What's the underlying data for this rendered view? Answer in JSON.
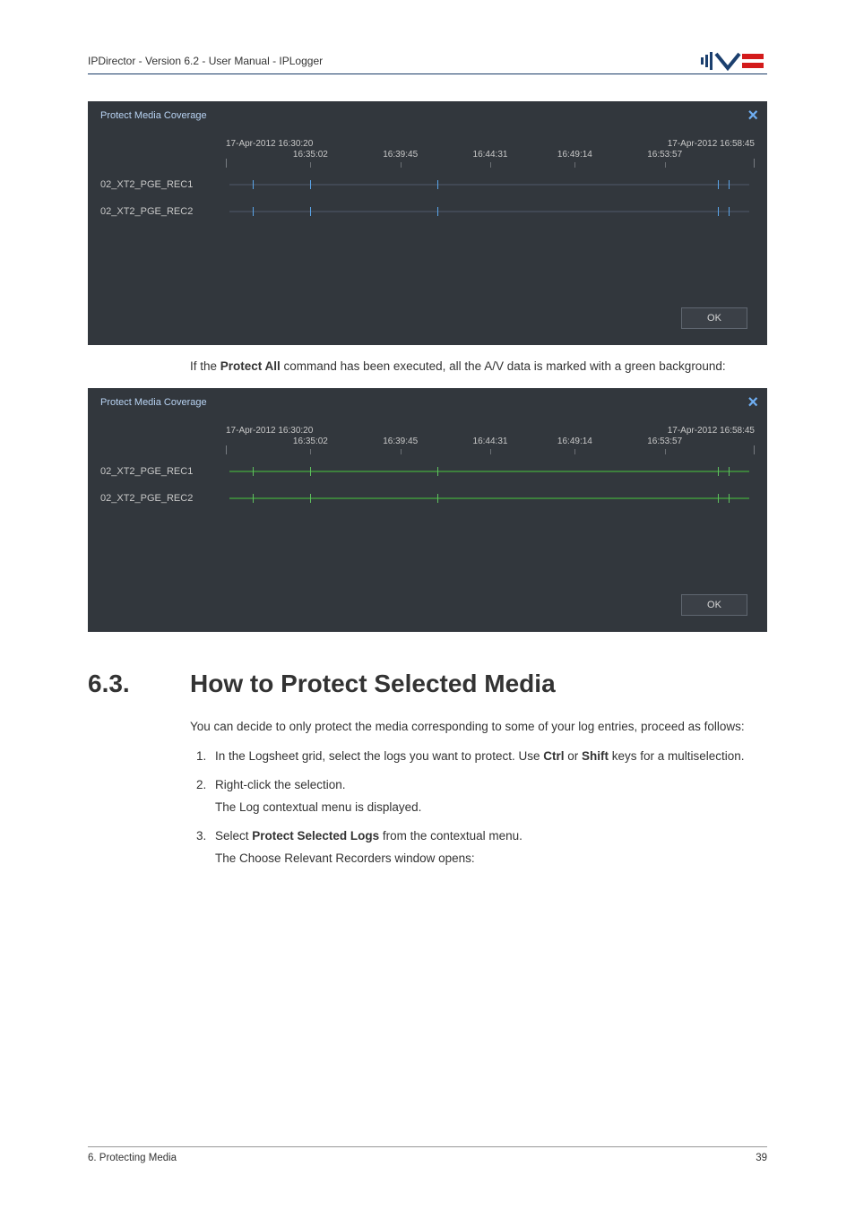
{
  "header": {
    "text": "IPDirector - Version 6.2 - User Manual - IPLogger"
  },
  "panel1": {
    "title": "Protect Media Coverage",
    "ok_label": "OK"
  },
  "panel2": {
    "title": "Protect Media Coverage",
    "ok_label": "OK"
  },
  "timeline": {
    "start_label": "17-Apr-2012 16:30:20",
    "end_label": "17-Apr-2012 16:58:45",
    "ticks": [
      {
        "pct": 16,
        "label": "16:35:02"
      },
      {
        "pct": 33,
        "label": "16:39:45"
      },
      {
        "pct": 50,
        "label": "16:44:31"
      },
      {
        "pct": 66,
        "label": "16:49:14"
      },
      {
        "pct": 83,
        "label": "16:53:57"
      }
    ],
    "tracks": [
      "02_XT2_PGE_REC1",
      "02_XT2_PGE_REC2"
    ],
    "track_marks_pct": [
      5,
      16,
      40,
      93,
      95
    ]
  },
  "text_between": "If the <b>Protect All</b> command has been executed, all the A/V data is marked with a green background:",
  "section": {
    "number": "6.3.",
    "title": "How to Protect Selected Media",
    "intro": "You can decide to only protect the media corresponding to some of your log entries, proceed as follows:",
    "step1": "In the Logsheet grid, select the logs you want to protect. Use <b>Ctrl</b> or <b>Shift</b> keys for a multiselection.",
    "step2": "Right-click the selection.",
    "step2_sub": "The Log contextual menu is displayed.",
    "step3": "Select <b>Protect Selected Logs</b> from the contextual menu.",
    "step3_sub": "The Choose Relevant Recorders window opens:"
  },
  "footer": {
    "left": "6. Protecting Media",
    "right": "39"
  },
  "chart_data": {
    "type": "timeline",
    "start": "17-Apr-2012 16:30:20",
    "end": "17-Apr-2012 16:58:45",
    "tick_times": [
      "16:35:02",
      "16:39:45",
      "16:44:31",
      "16:49:14",
      "16:53:57"
    ],
    "series": [
      {
        "name": "02_XT2_PGE_REC1",
        "panel1_state": "unprotected",
        "panel2_state": "protected"
      },
      {
        "name": "02_XT2_PGE_REC2",
        "panel1_state": "unprotected",
        "panel2_state": "protected"
      }
    ]
  }
}
